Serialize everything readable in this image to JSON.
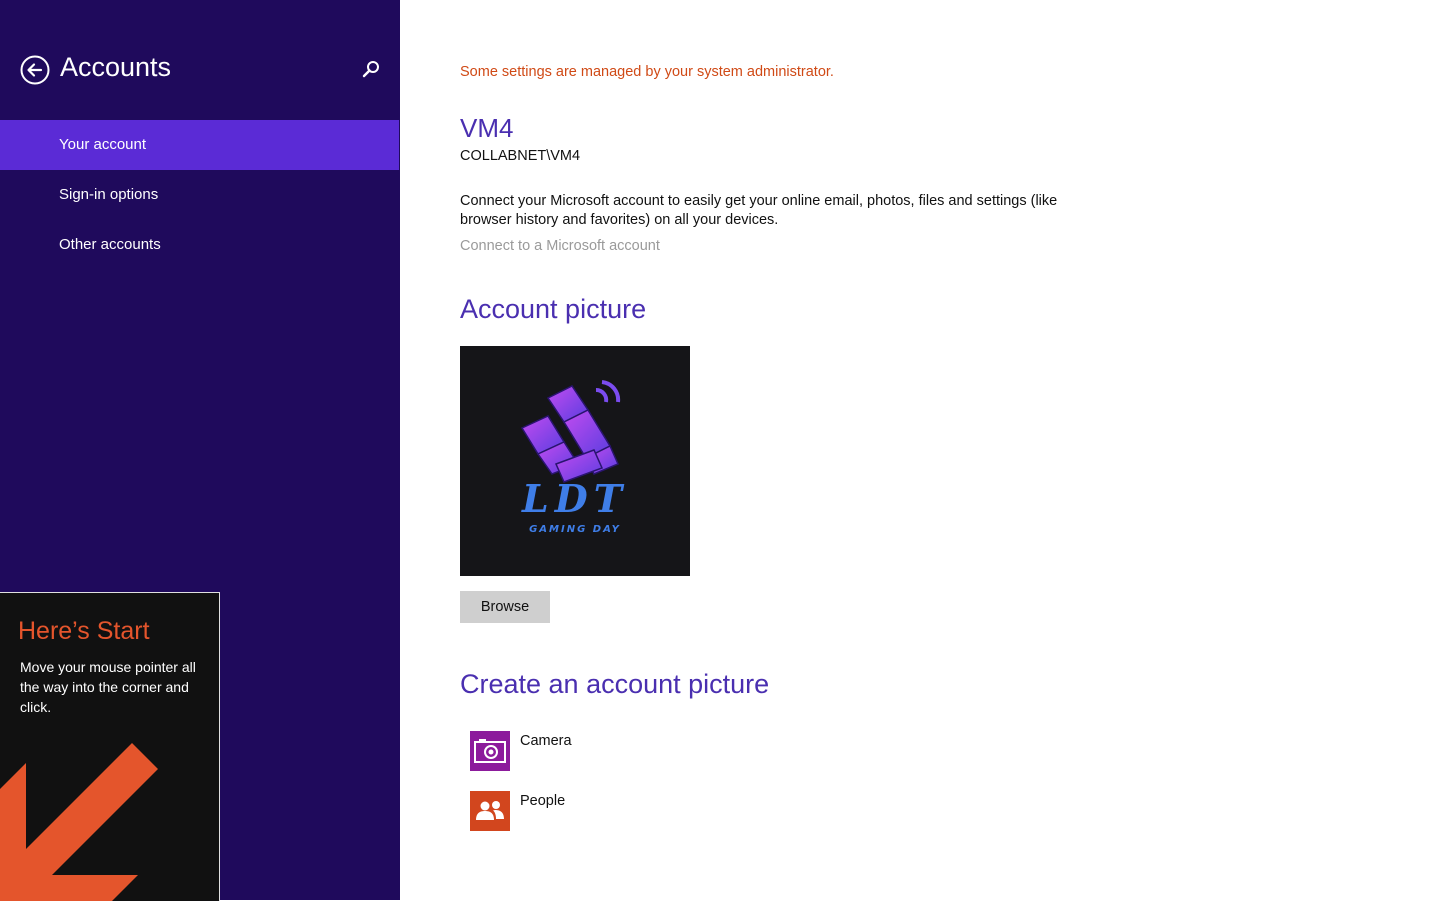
{
  "sidebar": {
    "title": "Accounts",
    "back_icon": "back-arrow-icon",
    "search_icon": "search-icon",
    "background": "#1f0a5c",
    "selected_background": "#5b2bd6",
    "items": [
      {
        "label": "Your account",
        "selected": true
      },
      {
        "label": "Sign-in options",
        "selected": false
      },
      {
        "label": "Other accounts",
        "selected": false
      }
    ]
  },
  "tip": {
    "title": "Here’s Start",
    "text": "Move your mouse pointer all the way into the corner and click.",
    "arrow_icon": "corner-arrow-icon",
    "accent": "#e4552c"
  },
  "main": {
    "admin_note": "Some settings are managed by your system administrator.",
    "user_name": "VM4",
    "user_domain": "COLLABNET\\VM4",
    "connect_description": "Connect your Microsoft account to easily get your online email, photos, files and settings (like browser history and favorites) on all your devices.",
    "connect_link": "Connect to a Microsoft account",
    "account_picture_title": "Account picture",
    "account_picture": {
      "logo_text": "LDT",
      "logo_subtext": "GAMING DAY"
    },
    "browse_label": "Browse",
    "create_title": "Create an account picture",
    "apps": [
      {
        "label": "Camera",
        "icon": "camera-icon",
        "color": "#8c1b9c"
      },
      {
        "label": "People",
        "icon": "people-icon",
        "color": "#d2461e"
      }
    ],
    "accent": "#4a2fb0",
    "warning_color": "#d04a16"
  }
}
